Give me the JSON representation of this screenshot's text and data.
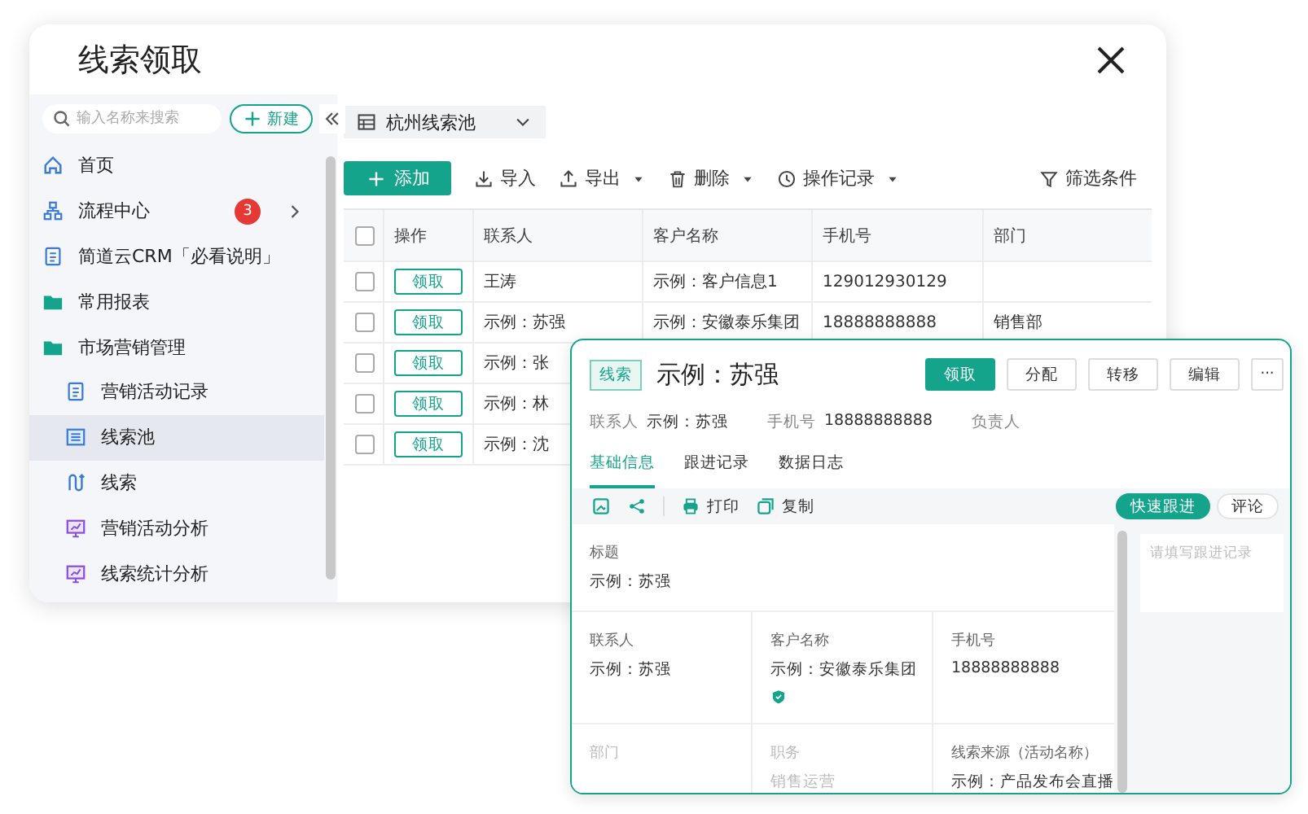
{
  "back_window": {
    "title": "线索领取",
    "sidebar": {
      "search": {
        "placeholder": "输入名称来搜索"
      },
      "new_button": "新建",
      "items": [
        {
          "label": "首页",
          "kind": "home",
          "selected": false
        },
        {
          "label": "流程中心",
          "kind": "process",
          "selected": false,
          "badge": "3"
        },
        {
          "label": "简道云CRM「必看说明」",
          "kind": "document",
          "selected": false
        },
        {
          "label": "常用报表",
          "kind": "folder",
          "selected": false
        },
        {
          "label": "市场营销管理",
          "kind": "folder",
          "selected": false,
          "children": [
            {
              "label": "营销活动记录",
              "kind": "document",
              "selected": false
            },
            {
              "label": "线索池",
              "kind": "form",
              "selected": true
            },
            {
              "label": "线索",
              "kind": "flow",
              "selected": false
            },
            {
              "label": "营销活动分析",
              "kind": "dashboard",
              "selected": false
            },
            {
              "label": "线索统计分析",
              "kind": "dashboard",
              "selected": false
            }
          ]
        }
      ]
    },
    "pool_selector": "杭州线索池",
    "toolbar": [
      {
        "label": "添加",
        "kind": "add"
      },
      {
        "label": "导入",
        "kind": "import"
      },
      {
        "label": "导出",
        "kind": "export",
        "menu": true
      },
      {
        "label": "删除",
        "kind": "delete",
        "menu": true
      },
      {
        "label": "操作记录",
        "kind": "history",
        "menu": true
      }
    ],
    "filter": "筛选条件",
    "table": {
      "checked": false,
      "columns": [
        "操作",
        "联系人",
        "客户名称",
        "手机号",
        "部门"
      ],
      "rows": [
        {
          "checked": false,
          "cells": [
            "领取",
            "王涛",
            "示例：客户信息1",
            "129012930129"
          ]
        },
        {
          "checked": false,
          "cells": [
            "领取",
            "示例：苏强",
            "示例：安徽泰乐集团",
            "18888888888",
            "销售部"
          ]
        },
        {
          "checked": false,
          "cells": [
            "领取",
            "示例：张"
          ]
        },
        {
          "checked": false,
          "cells": [
            "领取",
            "示例：林"
          ]
        },
        {
          "checked": false,
          "cells": [
            "领取",
            "示例：沈"
          ]
        }
      ]
    }
  },
  "detail_panel": {
    "tag": "线索",
    "title": "示例：苏强",
    "actions": [
      {
        "label": "领取",
        "primary": true
      },
      {
        "label": "分配",
        "primary": false
      },
      {
        "label": "转移",
        "primary": false
      },
      {
        "label": "编辑",
        "primary": false
      }
    ],
    "more": "···",
    "summary": [
      {
        "label": "联系人",
        "value": "示例：苏强"
      },
      {
        "label": "手机号",
        "value": "18888888888"
      },
      {
        "label": "负责人"
      }
    ],
    "tabs": [
      {
        "label": "基础信息",
        "selected": true
      },
      {
        "label": "跟进记录",
        "selected": false
      },
      {
        "label": "数据日志",
        "selected": false
      }
    ],
    "tools": [
      {
        "label": "打印",
        "kind": "print"
      },
      {
        "label": "复制",
        "kind": "copy"
      }
    ],
    "side_tabs": [
      {
        "label": "快速跟进",
        "selected": true
      },
      {
        "label": "评论",
        "selected": false
      }
    ],
    "follow_up": {
      "placeholder": "请填写跟进记录"
    },
    "fields": [
      {
        "label": "标题",
        "value": "示例：苏强",
        "wide": true,
        "disabled": false
      },
      {
        "label": "联系人",
        "value": "示例：苏强",
        "disabled": false
      },
      {
        "label": "客户名称",
        "value": "示例：安徽泰乐集团",
        "verified": true,
        "disabled": false
      },
      {
        "label": "手机号",
        "value": "18888888888",
        "disabled": false
      },
      {
        "label": "部门",
        "disabled": true
      },
      {
        "label": "职务",
        "value": "销售运营",
        "disabled": true
      },
      {
        "label": "线索来源（活动名称）",
        "value": "示例：产品发布会直播",
        "disabled": false
      }
    ]
  }
}
